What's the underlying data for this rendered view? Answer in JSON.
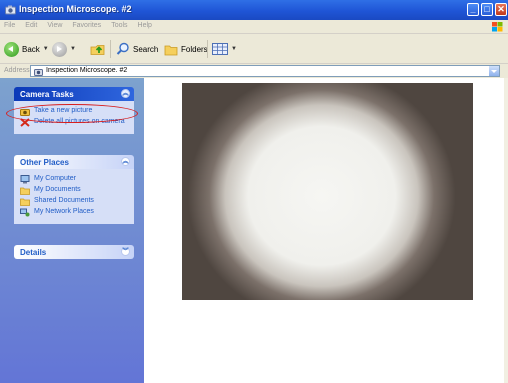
{
  "window": {
    "title": "Inspection Microscope. #2",
    "controls": {
      "minimize": "_",
      "maximize": "□",
      "close": "✕"
    }
  },
  "menu": [
    "File",
    "Edit",
    "View",
    "Favorites",
    "Tools",
    "Help"
  ],
  "toolbar": {
    "back_label": "Back",
    "search_label": "Search",
    "folders_label": "Folders"
  },
  "address": {
    "label": "Address",
    "value": "Inspection Microscope. #2"
  },
  "sidebar": {
    "camera_tasks": {
      "title": "Camera Tasks",
      "items": [
        {
          "label": "Take a new picture",
          "icon": "camera-icon"
        },
        {
          "label": "Delete all pictures on camera",
          "icon": "delete-x-icon"
        }
      ]
    },
    "other_places": {
      "title": "Other Places",
      "items": [
        {
          "label": "My Computer",
          "icon": "computer-icon"
        },
        {
          "label": "My Documents",
          "icon": "folder-icon"
        },
        {
          "label": "Shared Documents",
          "icon": "folder-icon"
        },
        {
          "label": "My Network Places",
          "icon": "network-icon"
        }
      ]
    },
    "details": {
      "title": "Details"
    }
  },
  "colors": {
    "title_bar": "#1f55d6",
    "sidebar": "#7d96d4",
    "link": "#215dc6",
    "highlight": "#d81e1e"
  }
}
